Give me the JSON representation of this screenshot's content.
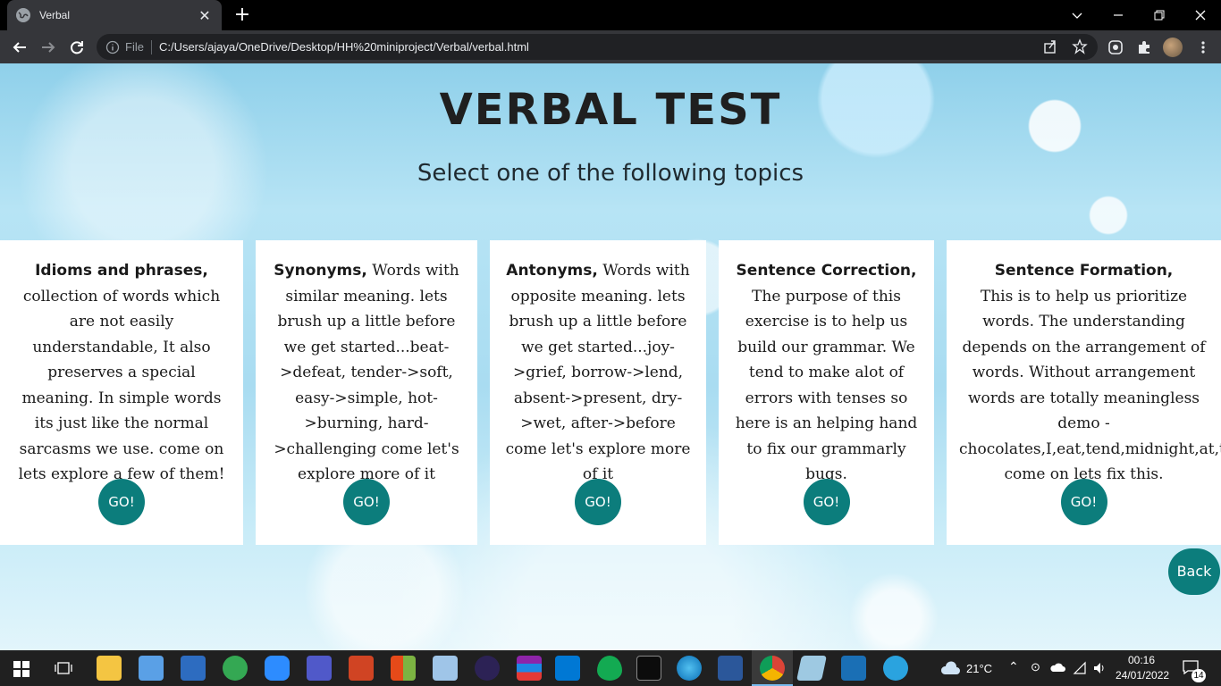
{
  "browser": {
    "tab_title": "Verbal",
    "file_label": "File",
    "url": "C:/Users/ajaya/OneDrive/Desktop/HH%20miniproject/Verbal/verbal.html"
  },
  "page": {
    "title": "VERBAL TEST",
    "subtitle": "Select one of the following topics",
    "cards": [
      {
        "title": "Idioms and phrases,",
        "body": "collection of words which are not easily understandable, It also preserves a special meaning. In simple words its just like the normal sarcasms we use. come on lets explore a few of them!",
        "button": "GO!"
      },
      {
        "title": "Synonyms,",
        "body": " Words with similar meaning. lets brush up a little before we get started...beat->defeat, tender->soft, easy->simple, hot->burning, hard->challenging come let's explore more of it",
        "button": "GO!"
      },
      {
        "title": "Antonyms,",
        "body": " Words with opposite meaning. lets brush up a little before we get started...joy->grief, borrow->lend, absent->present, dry->wet, after->before come let's explore more of it",
        "button": "GO!"
      },
      {
        "title": "Sentence Correction,",
        "body": "The purpose of this exercise is to help us build our grammar. We tend to make alot of errors with tenses so here is an helping hand to fix our grammarly bugs.",
        "button": "GO!"
      },
      {
        "title": "Sentence Formation,",
        "body": "This is to help us prioritize words. The understanding depends on the arrangement of words. Without arrangement words are totally meaningless demo - chocolates,I,eat,tend,midnight,at,to come on lets fix this.",
        "button": "GO!"
      }
    ],
    "back_button": "Back"
  },
  "taskbar": {
    "weather": "21°C",
    "time": "00:16",
    "date": "24/01/2022",
    "notification_count": "14"
  },
  "colors": {
    "accent": "#0c7d7c",
    "card_bg": "#ffffff",
    "chrome_bg": "#35363a"
  }
}
